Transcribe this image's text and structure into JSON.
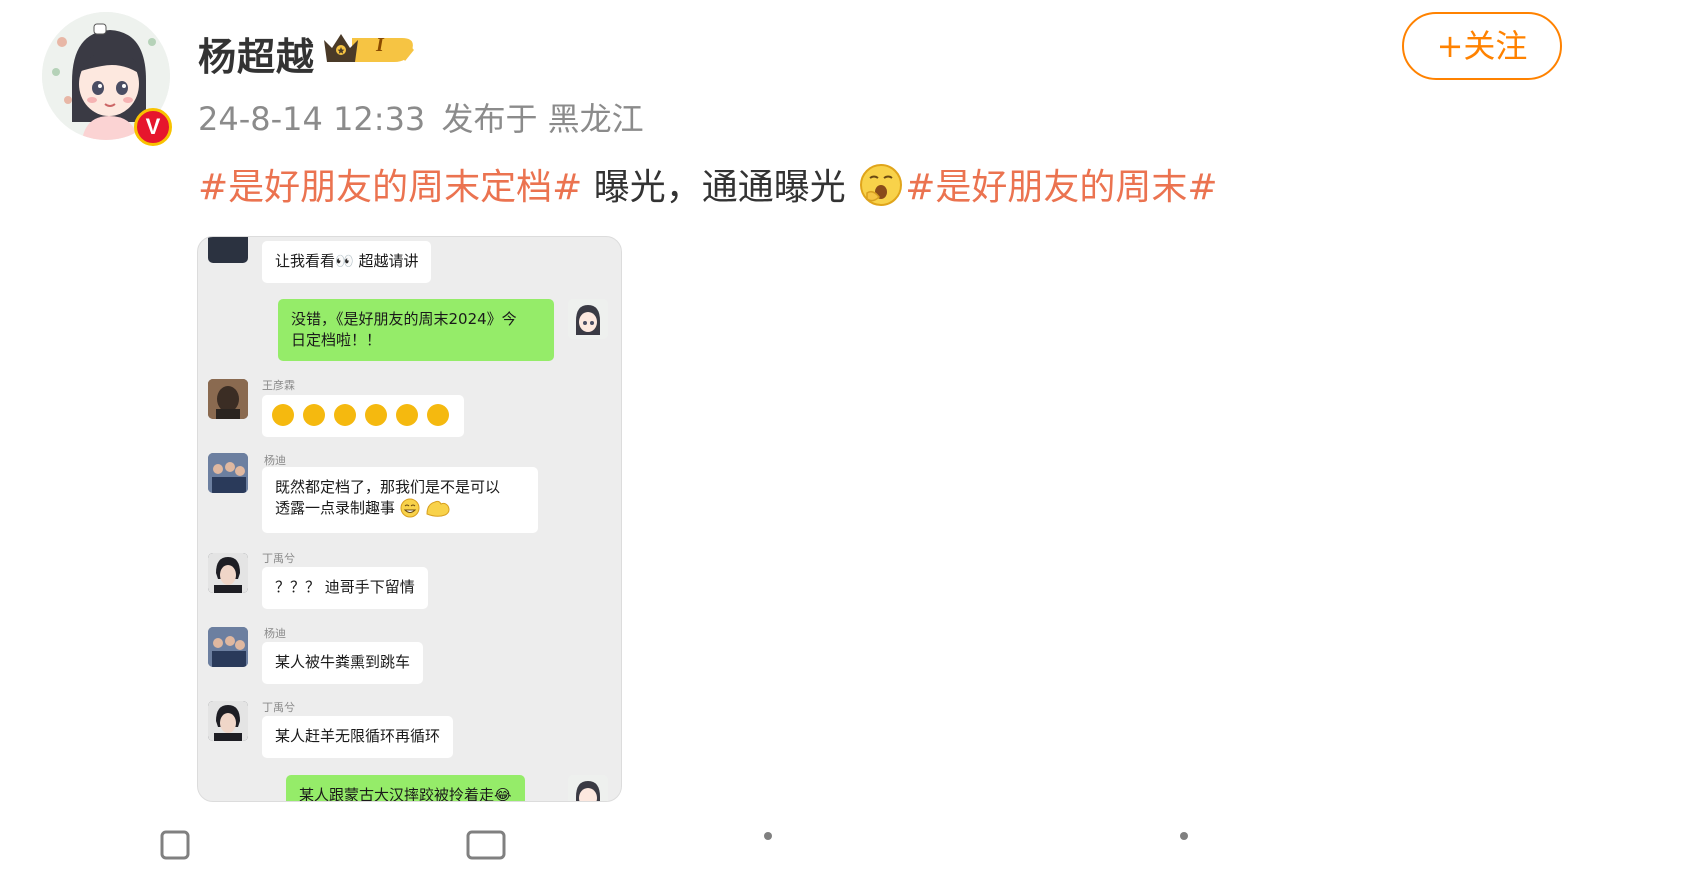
{
  "post": {
    "author": "杨超越",
    "timestamp": "24-8-14 12:33",
    "source": "发布于 黑龙江",
    "follow_label": "+关注",
    "verified_badge": "V",
    "vip_level": "I",
    "text": {
      "hashtag1": "#是好朋友的周末定档#",
      "body": " 曝光，通通曝光 ",
      "hashtag2": "#是好朋友的周末#"
    },
    "colors": {
      "hashtag": "#eb7350",
      "follow": "#ff8200",
      "meta": "#8b8b8b"
    }
  },
  "chat": {
    "messages": [
      {
        "sender": "",
        "text": "让我看看👀 超越请讲",
        "side": "left"
      },
      {
        "sender": "",
        "text_line1": "没错，《是好朋友的周末2024》今",
        "text_line2": "日定档啦！！",
        "side": "right"
      },
      {
        "sender": "王彦霖",
        "text": "clap x6",
        "side": "left"
      },
      {
        "sender": "杨迪",
        "text_line1": "既然都定档了，那我们是不是可以",
        "text_line2": "透露一点录制趣事",
        "side": "left"
      },
      {
        "sender": "丁禹兮",
        "text": "？？？ 迪哥手下留情",
        "side": "left"
      },
      {
        "sender": "杨迪",
        "text": "某人被牛粪熏到跳车",
        "side": "left"
      },
      {
        "sender": "丁禹兮",
        "text": "某人赶羊无限循环再循环",
        "side": "left"
      },
      {
        "sender": "",
        "text": "某人跟蒙古大汉摔跤被拎着走😂",
        "side": "right"
      }
    ]
  },
  "icons": [
    "verified-v-icon",
    "vip-crown-icon",
    "yawn-emoji-icon",
    "clap-emoji-icon",
    "grin-emoji-icon",
    "flex-emoji-icon",
    "share-icon",
    "comment-icon",
    "like-icon"
  ]
}
